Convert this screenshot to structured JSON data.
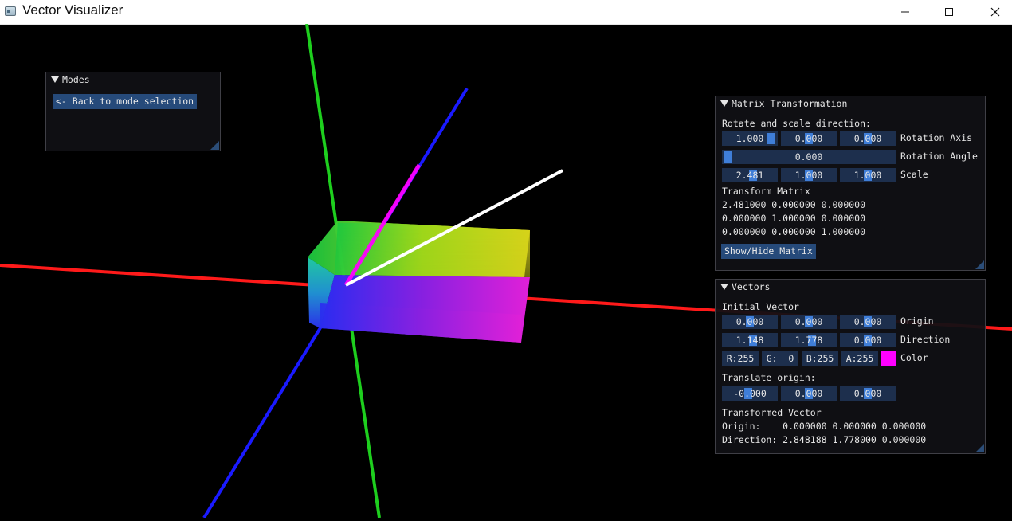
{
  "window": {
    "title": "Vector Visualizer"
  },
  "modes": {
    "header": "Modes",
    "back_button": "<- Back to mode selection"
  },
  "matrix": {
    "header": "Matrix Transformation",
    "subtitle": "Rotate and scale direction:",
    "rotation_axis": {
      "values": [
        "1.000",
        "0.000",
        "0.000"
      ],
      "label": "Rotation Axis"
    },
    "rotation_angle": {
      "value": "0.000",
      "label": "Rotation Angle"
    },
    "scale": {
      "values": [
        "2.481",
        "1.000",
        "1.000"
      ],
      "label": "Scale"
    },
    "transform_label": "Transform Matrix",
    "rows": [
      "2.481000 0.000000 0.000000",
      "0.000000 1.000000 0.000000",
      "0.000000 0.000000 1.000000"
    ],
    "toggle_button": "Show/Hide Matrix"
  },
  "vectors": {
    "header": "Vectors",
    "initial_label": "Initial Vector",
    "origin": {
      "values": [
        "0.000",
        "0.000",
        "0.000"
      ],
      "label": "Origin"
    },
    "direction": {
      "values": [
        "1.148",
        "1.778",
        "0.000"
      ],
      "label": "Direction"
    },
    "color": {
      "r": "R:255",
      "g": "G:  0",
      "b": "B:255",
      "a": "A:255",
      "label": "Color",
      "hex": "#ff00ff"
    },
    "translate_label": "Translate origin:",
    "translate": {
      "values": [
        "-0.000",
        "0.000",
        "0.000"
      ]
    },
    "transformed_label": "Transformed Vector",
    "transformed_origin": "Origin:    0.000000 0.000000 0.000000",
    "transformed_direction": "Direction: 2.848188 1.778000 0.000000"
  },
  "colors": {
    "x_axis": "#ff1a1a",
    "y_axis": "#1ecf1e",
    "z_axis": "#1a1aff",
    "vector_initial": "#ff00ff",
    "vector_transformed": "#ffffff",
    "panel_bg": "#101014",
    "widget_bg": "#1d2f4d",
    "accent": "#3f7ed8"
  }
}
